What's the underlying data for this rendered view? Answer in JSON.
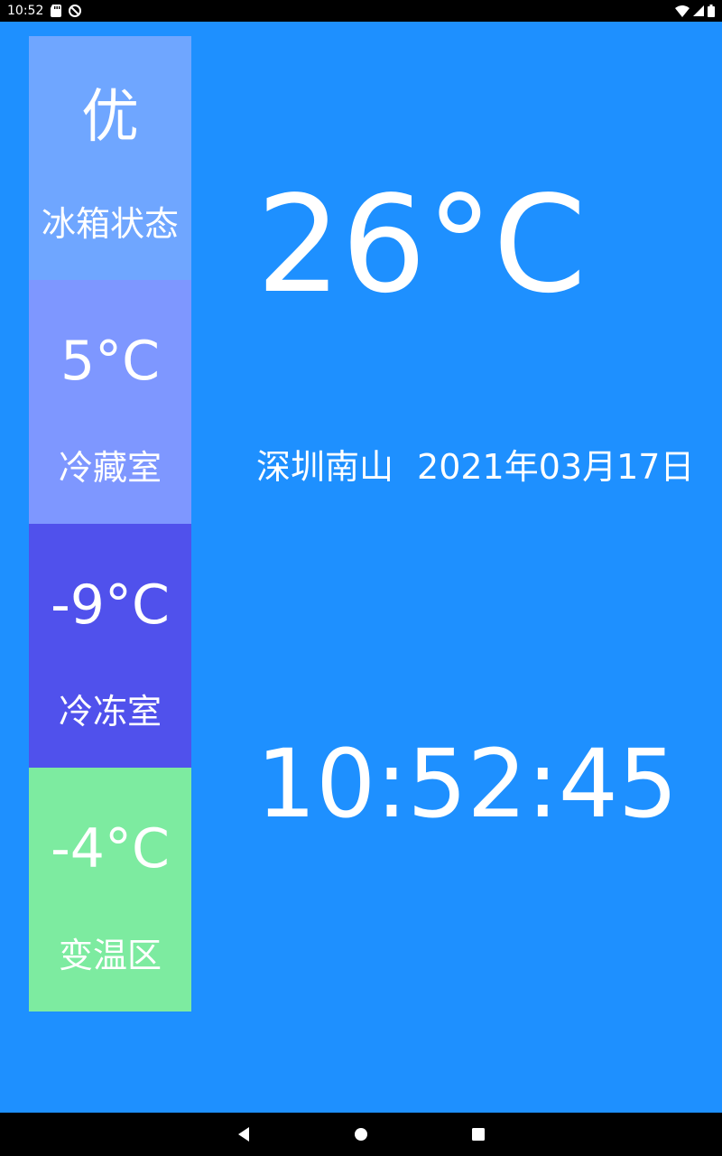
{
  "status_bar": {
    "time": "10:52",
    "icons": [
      "sd-card-icon",
      "no-disturb-icon",
      "wifi-icon",
      "signal-icon",
      "battery-icon"
    ]
  },
  "colors": {
    "background": "#1E90FF",
    "status_card": "#6FA6FF",
    "fridge_card": "#7E97FF",
    "freezer_card": "#5051EC",
    "variable_card": "#7DEBA0"
  },
  "cards": [
    {
      "value": "优",
      "label": "冰箱状态"
    },
    {
      "value": "5°C",
      "label": "冷藏室"
    },
    {
      "value": "-9°C",
      "label": "冷冻室"
    },
    {
      "value": "-4°C",
      "label": "变温区"
    }
  ],
  "main": {
    "temperature": "26°C",
    "location": "深圳南山",
    "date": "2021年03月17日",
    "clock": "10:52:45"
  },
  "nav_bar": {
    "buttons": [
      "back-icon",
      "home-icon",
      "recents-icon"
    ]
  }
}
